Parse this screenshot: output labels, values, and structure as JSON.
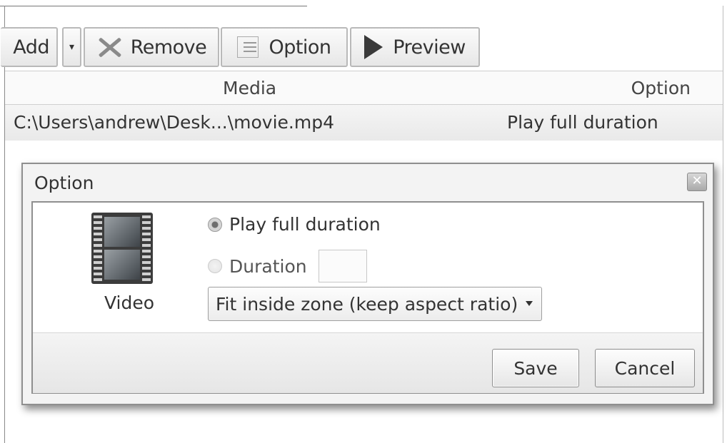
{
  "toolbar": {
    "add_label": "Add",
    "add_dropdown": "▾",
    "remove_label": "Remove",
    "option_label": "Option",
    "preview_label": "Preview"
  },
  "table": {
    "columns": [
      "Media",
      "Option"
    ],
    "rows": [
      {
        "media": "C:\\Users\\andrew\\Desk...\\movie.mp4",
        "option": "Play full duration"
      }
    ]
  },
  "dialog": {
    "title": "Option",
    "close_glyph": "✕",
    "media_type_label": "Video",
    "radio_full": "Play full duration",
    "radio_duration": "Duration",
    "duration_value": "",
    "scale_mode": "Fit inside zone (keep aspect ratio)",
    "save_label": "Save",
    "cancel_label": "Cancel"
  }
}
